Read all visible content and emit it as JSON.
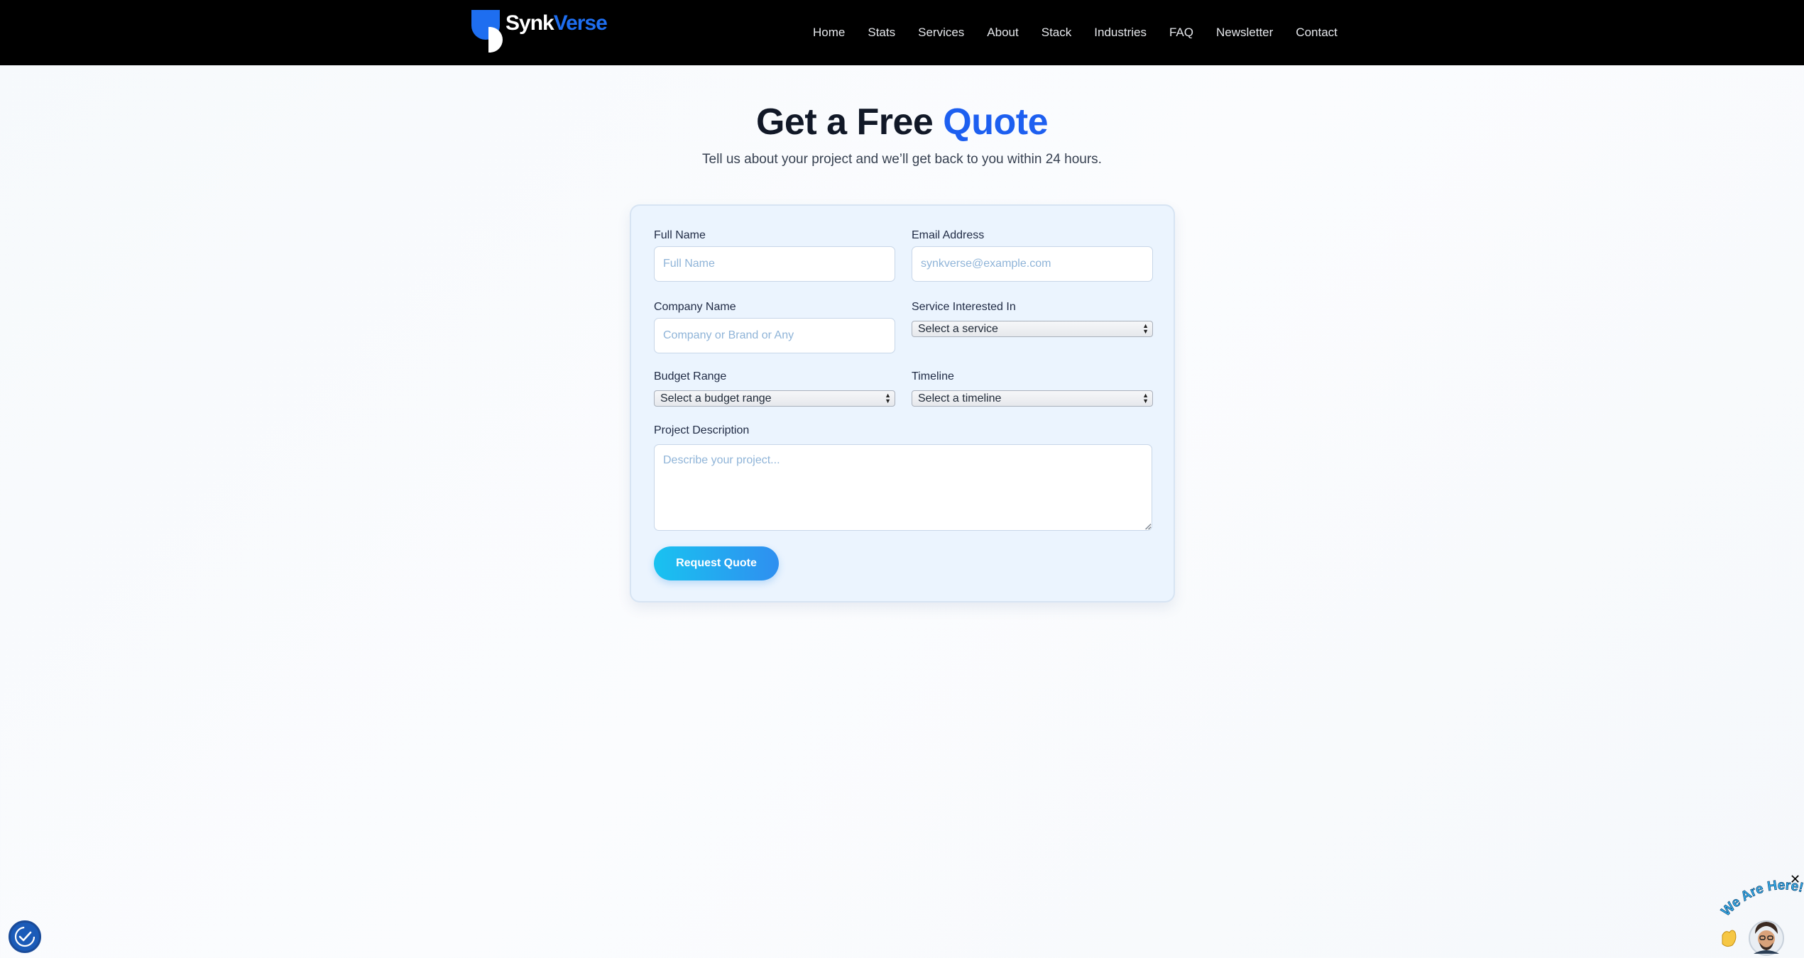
{
  "brand": {
    "name_part1": "Synk",
    "name_part2": "Verse",
    "primary_color": "#1e6ef0"
  },
  "nav": {
    "items": [
      {
        "label": "Home"
      },
      {
        "label": "Stats"
      },
      {
        "label": "Services"
      },
      {
        "label": "About"
      },
      {
        "label": "Stack"
      },
      {
        "label": "Industries"
      },
      {
        "label": "FAQ"
      },
      {
        "label": "Newsletter"
      },
      {
        "label": "Contact"
      }
    ]
  },
  "hero": {
    "title_prefix": "Get a Free",
    "title_accent": "Quote",
    "subtitle": "Tell us about your project and we’ll get back to you within 24 hours."
  },
  "form": {
    "full_name": {
      "label": "Full Name",
      "placeholder": "Full Name",
      "value": ""
    },
    "email": {
      "label": "Email Address",
      "placeholder": "synkverse@example.com",
      "value": ""
    },
    "company": {
      "label": "Company Name",
      "placeholder": "Company or Brand or Any",
      "value": ""
    },
    "service": {
      "label": "Service Interested In",
      "selected": "Select a service"
    },
    "budget": {
      "label": "Budget Range",
      "selected": "Select a budget range"
    },
    "timeline": {
      "label": "Timeline",
      "selected": "Select a timeline"
    },
    "description": {
      "label": "Project Description",
      "placeholder": "Describe your project...",
      "value": ""
    },
    "submit_label": "Request Quote"
  },
  "widgets": {
    "accessibility_icon": "accessibility-check-icon",
    "chat_icon": "avatar-chat-icon",
    "chat_banner_text": "We Are Here!",
    "close_icon": "close-icon",
    "close_glyph": "✕"
  },
  "colors": {
    "accent_blue": "#1d5ff0",
    "button_gradient_start": "#19c2f0",
    "button_gradient_end": "#2f8ff0",
    "navbar_bg": "#000000",
    "card_bg": "#ebf4fe"
  }
}
